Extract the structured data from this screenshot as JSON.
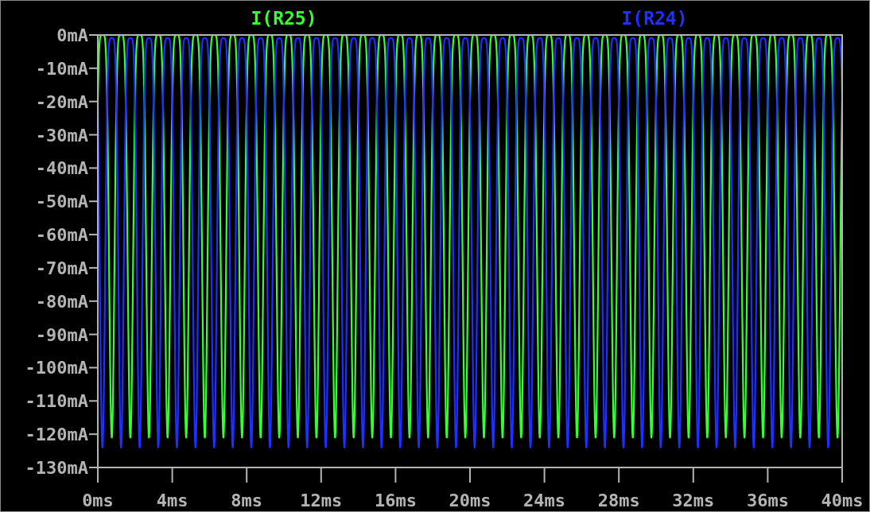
{
  "traces": [
    {
      "label": "I(R25)",
      "color": "#33ff33"
    },
    {
      "label": "I(R24)",
      "color": "#1f2fff"
    }
  ],
  "y_axis": {
    "ticks": [
      "0mA",
      "-10mA",
      "-20mA",
      "-30mA",
      "-40mA",
      "-50mA",
      "-60mA",
      "-70mA",
      "-80mA",
      "-90mA",
      "-100mA",
      "-110mA",
      "-120mA",
      "-130mA"
    ]
  },
  "x_axis": {
    "ticks": [
      "0ms",
      "4ms",
      "8ms",
      "12ms",
      "16ms",
      "20ms",
      "24ms",
      "28ms",
      "32ms",
      "36ms",
      "40ms"
    ]
  }
}
